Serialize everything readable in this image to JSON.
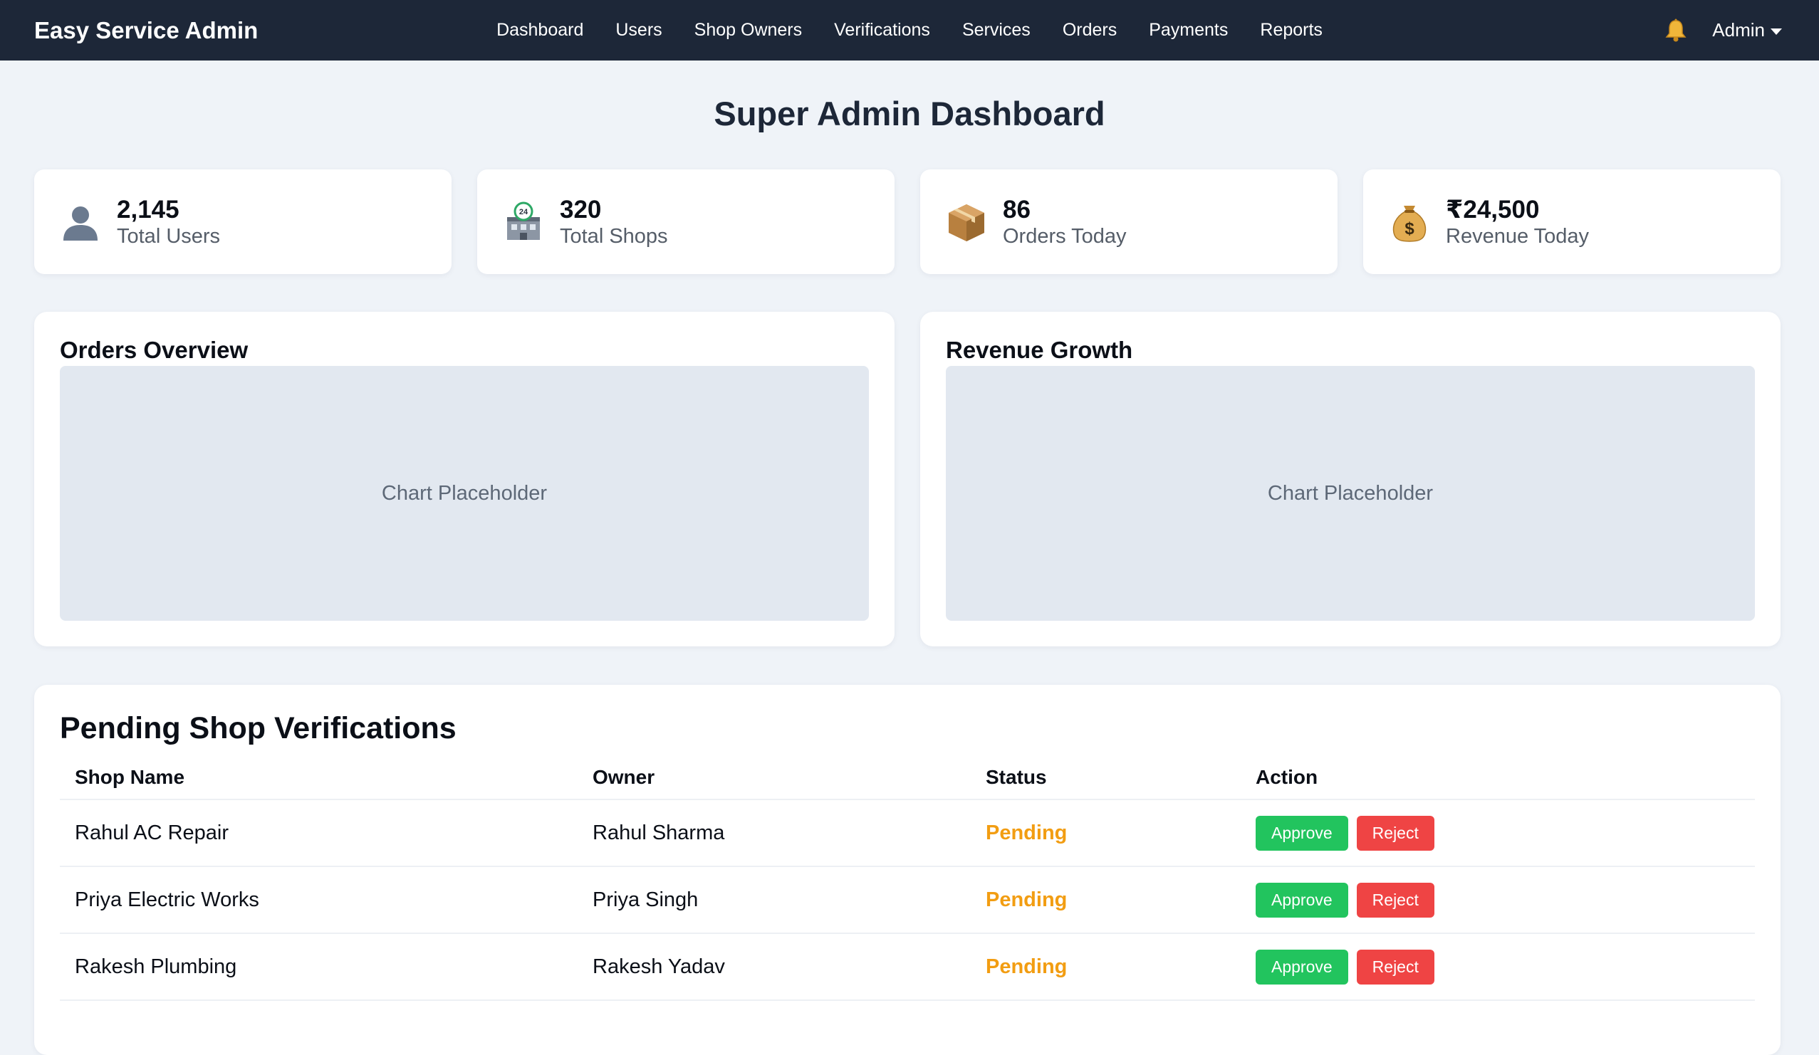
{
  "header": {
    "brand": "Easy Service Admin",
    "nav": [
      "Dashboard",
      "Users",
      "Shop Owners",
      "Verifications",
      "Services",
      "Orders",
      "Payments",
      "Reports"
    ],
    "notification_icon": "bell-icon",
    "user_menu": "Admin"
  },
  "page": {
    "title": "Super Admin Dashboard"
  },
  "stats": [
    {
      "icon": "user-icon",
      "value": "2,145",
      "label": "Total Users"
    },
    {
      "icon": "shop-icon",
      "value": "320",
      "label": "Total Shops"
    },
    {
      "icon": "package-icon",
      "value": "86",
      "label": "Orders Today"
    },
    {
      "icon": "money-bag-icon",
      "value": "₹24,500",
      "label": "Revenue Today"
    }
  ],
  "charts": [
    {
      "title": "Orders Overview",
      "placeholder": "Chart Placeholder"
    },
    {
      "title": "Revenue Growth",
      "placeholder": "Chart Placeholder"
    }
  ],
  "verifications": {
    "title": "Pending Shop Verifications",
    "columns": [
      "Shop Name",
      "Owner",
      "Status",
      "Action"
    ],
    "rows": [
      {
        "shop": "Rahul AC Repair",
        "owner": "Rahul Sharma",
        "status": "Pending",
        "approve": "Approve",
        "reject": "Reject"
      },
      {
        "shop": "Priya Electric Works",
        "owner": "Priya Singh",
        "status": "Pending",
        "approve": "Approve",
        "reject": "Reject"
      },
      {
        "shop": "Rakesh Plumbing",
        "owner": "Rakesh Yadav",
        "status": "Pending",
        "approve": "Approve",
        "reject": "Reject"
      }
    ]
  },
  "colors": {
    "topbar": "#1d2738",
    "background": "#eff3f8",
    "pending": "#f29d12",
    "approve": "#22c45e",
    "reject": "#ef4444"
  }
}
